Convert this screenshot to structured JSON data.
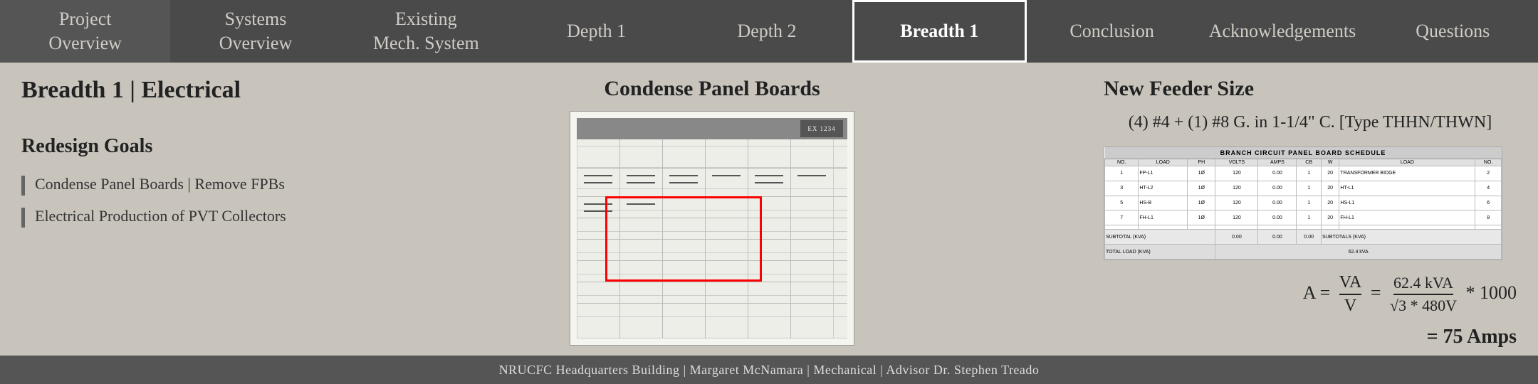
{
  "nav": {
    "items": [
      {
        "id": "project-overview",
        "label": "Project\nOverview",
        "active": false
      },
      {
        "id": "systems-overview",
        "label": "Systems\nOverview",
        "active": false
      },
      {
        "id": "existing-mech",
        "label": "Existing\nMech. System",
        "active": false
      },
      {
        "id": "depth1",
        "label": "Depth 1",
        "active": false
      },
      {
        "id": "depth2",
        "label": "Depth 2",
        "active": false
      },
      {
        "id": "breadth1",
        "label": "Breadth 1",
        "active": true
      },
      {
        "id": "conclusion",
        "label": "Conclusion",
        "active": false
      },
      {
        "id": "acknowledgements",
        "label": "Acknowledgements",
        "active": false
      },
      {
        "id": "questions",
        "label": "Questions",
        "active": false
      }
    ]
  },
  "left": {
    "page_title": "Breadth 1 | Electrical",
    "redesign_header": "Redesign Goals",
    "goals": [
      "Condense Panel Boards | Remove FPBs",
      "Electrical Production of PVT Collectors"
    ]
  },
  "center": {
    "title": "Condense Panel Boards"
  },
  "right": {
    "title": "New Feeder Size",
    "feeder_wire": "(4) #4 + (1) #8 G. in 1-1/4\" C. [Type THHN/THWN]",
    "schedule_title": "BRANCH CIRCUIT PANEL BOARD SCHEDULE",
    "formula_label": "A =",
    "formula_va": "VA",
    "formula_v": "V",
    "formula_value": "62.4 kVA",
    "formula_denom": "√3 * 480V",
    "formula_mult": "* 1000",
    "result": "= 75 Amps"
  },
  "footer": {
    "text": "NRUCFC Headquarters Building | Margaret McNamara | Mechanical | Advisor Dr. Stephen Treado"
  }
}
